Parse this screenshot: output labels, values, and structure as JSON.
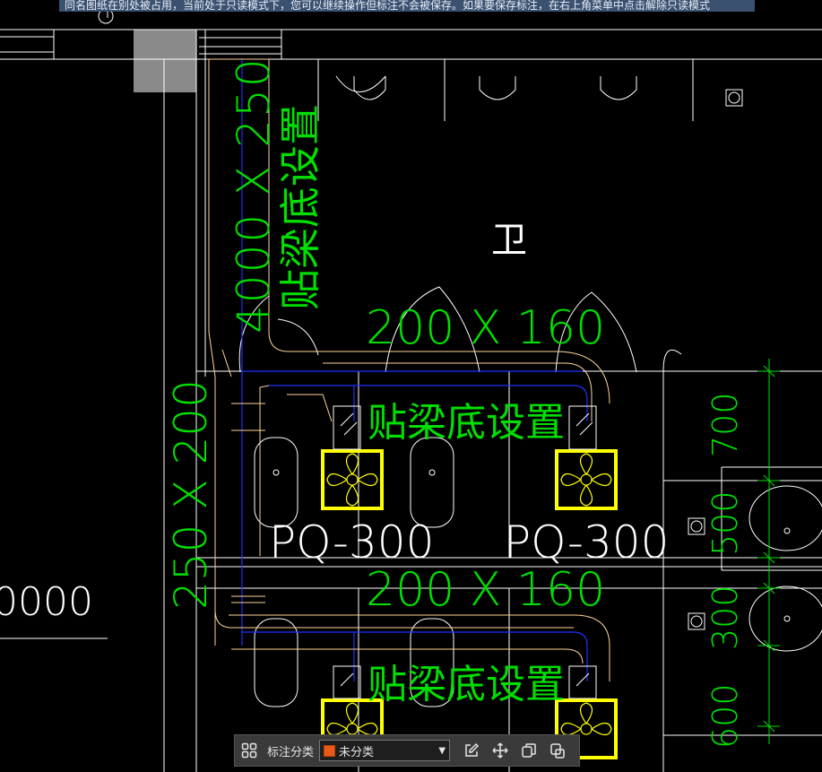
{
  "banner": {
    "text": "同名图纸在别处被占用，当前处于只读模式下，您可以继续操作但标注不会被保存。如果要保存标注，在右上角菜单中点击解除只读模式"
  },
  "drawing": {
    "labels": {
      "duct_main": "4000 X 250",
      "duct_main_note": "贴梁底设置",
      "room": "卫",
      "branch_upper": "200 X 160",
      "branch_upper_note": "贴梁底设置",
      "duct_left": "250 X 200",
      "fan_left": "PQ-300",
      "fan_right": "PQ-300",
      "branch_lower": "200 X 160",
      "branch_lower_note": "贴梁底设置",
      "dim_700": "700",
      "dim_500": "500",
      "dim_300": "300",
      "dim_600": "600",
      "left_dim": "0000"
    }
  },
  "toolbar": {
    "layout_icon": "grid-layout-icon",
    "category_label": "标注分类",
    "category_value": "未分类",
    "category_color": "#e85a1a",
    "edit_icon": "edit-icon",
    "move_icon": "move-icon",
    "copy_icon": "copy-icon",
    "paste_icon": "paste-icon"
  }
}
